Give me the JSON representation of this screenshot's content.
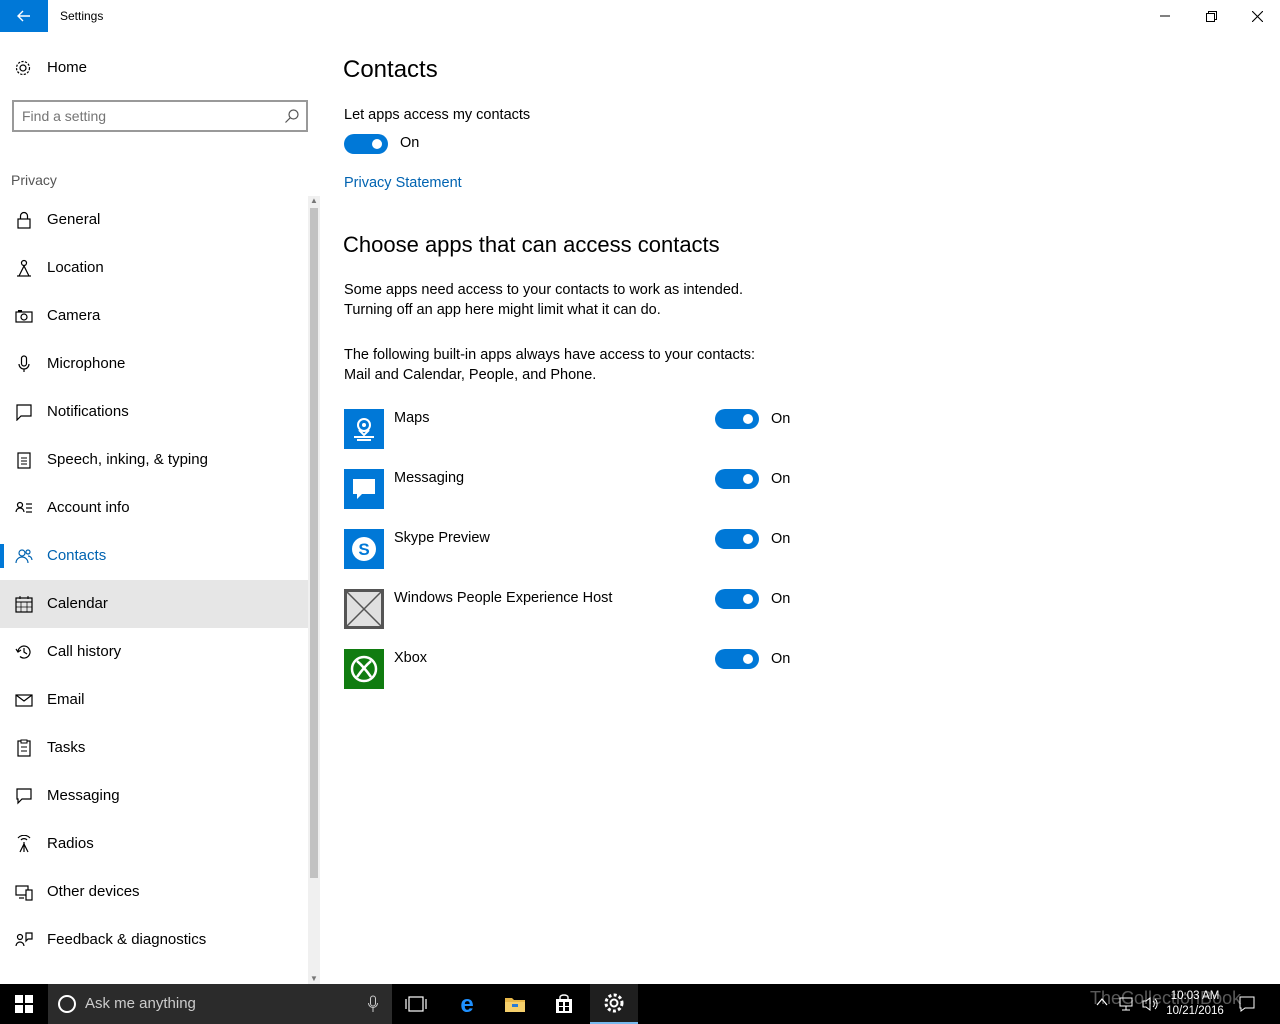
{
  "window": {
    "title": "Settings"
  },
  "sidebar": {
    "home_label": "Home",
    "search_placeholder": "Find a setting",
    "section_label": "Privacy",
    "items": [
      {
        "label": "General",
        "icon": "lock-icon"
      },
      {
        "label": "Location",
        "icon": "location-person-icon"
      },
      {
        "label": "Camera",
        "icon": "camera-icon"
      },
      {
        "label": "Microphone",
        "icon": "microphone-icon"
      },
      {
        "label": "Notifications",
        "icon": "notifications-icon"
      },
      {
        "label": "Speech, inking, & typing",
        "icon": "clipboard-icon"
      },
      {
        "label": "Account info",
        "icon": "account-info-icon"
      },
      {
        "label": "Contacts",
        "icon": "contacts-icon"
      },
      {
        "label": "Calendar",
        "icon": "calendar-icon"
      },
      {
        "label": "Call history",
        "icon": "history-icon"
      },
      {
        "label": "Email",
        "icon": "email-icon"
      },
      {
        "label": "Tasks",
        "icon": "tasks-icon"
      },
      {
        "label": "Messaging",
        "icon": "messaging-icon"
      },
      {
        "label": "Radios",
        "icon": "radios-icon"
      },
      {
        "label": "Other devices",
        "icon": "other-devices-icon"
      },
      {
        "label": "Feedback & diagnostics",
        "icon": "feedback-icon"
      }
    ],
    "active_item": "Contacts",
    "hover_item": "Calendar"
  },
  "main": {
    "title": "Contacts",
    "master_toggle_label": "Let apps access my contacts",
    "master_toggle_state": "On",
    "privacy_link": "Privacy Statement",
    "section_title": "Choose apps that can access contacts",
    "description_line1": "Some apps need access to your contacts to work as intended.",
    "description_line2": "Turning off an app here might limit what it can do.",
    "builtin_line1": "The following built-in apps always have access to your contacts:",
    "builtin_line2": "Mail and Calendar, People, and Phone.",
    "apps": [
      {
        "name": "Maps",
        "state": "On",
        "tile_color": "#0078d7",
        "icon": "maps-icon"
      },
      {
        "name": "Messaging",
        "state": "On",
        "tile_color": "#0078d7",
        "icon": "message-bubble-icon"
      },
      {
        "name": "Skype Preview",
        "state": "On",
        "tile_color": "#0078d7",
        "icon": "skype-icon"
      },
      {
        "name": "Windows People Experience Host",
        "state": "On",
        "tile_color": "#555555",
        "icon": "placeholder-app-icon"
      },
      {
        "name": "Xbox",
        "state": "On",
        "tile_color": "#107c10",
        "icon": "xbox-icon"
      }
    ]
  },
  "taskbar": {
    "search_placeholder": "Ask me anything",
    "time": "10:03 AM",
    "date": "10/21/2016",
    "watermark": "TheCollectionBook"
  },
  "colors": {
    "accent": "#0078d7",
    "link": "#0063b1",
    "hover_bg": "#e6e6e6"
  }
}
